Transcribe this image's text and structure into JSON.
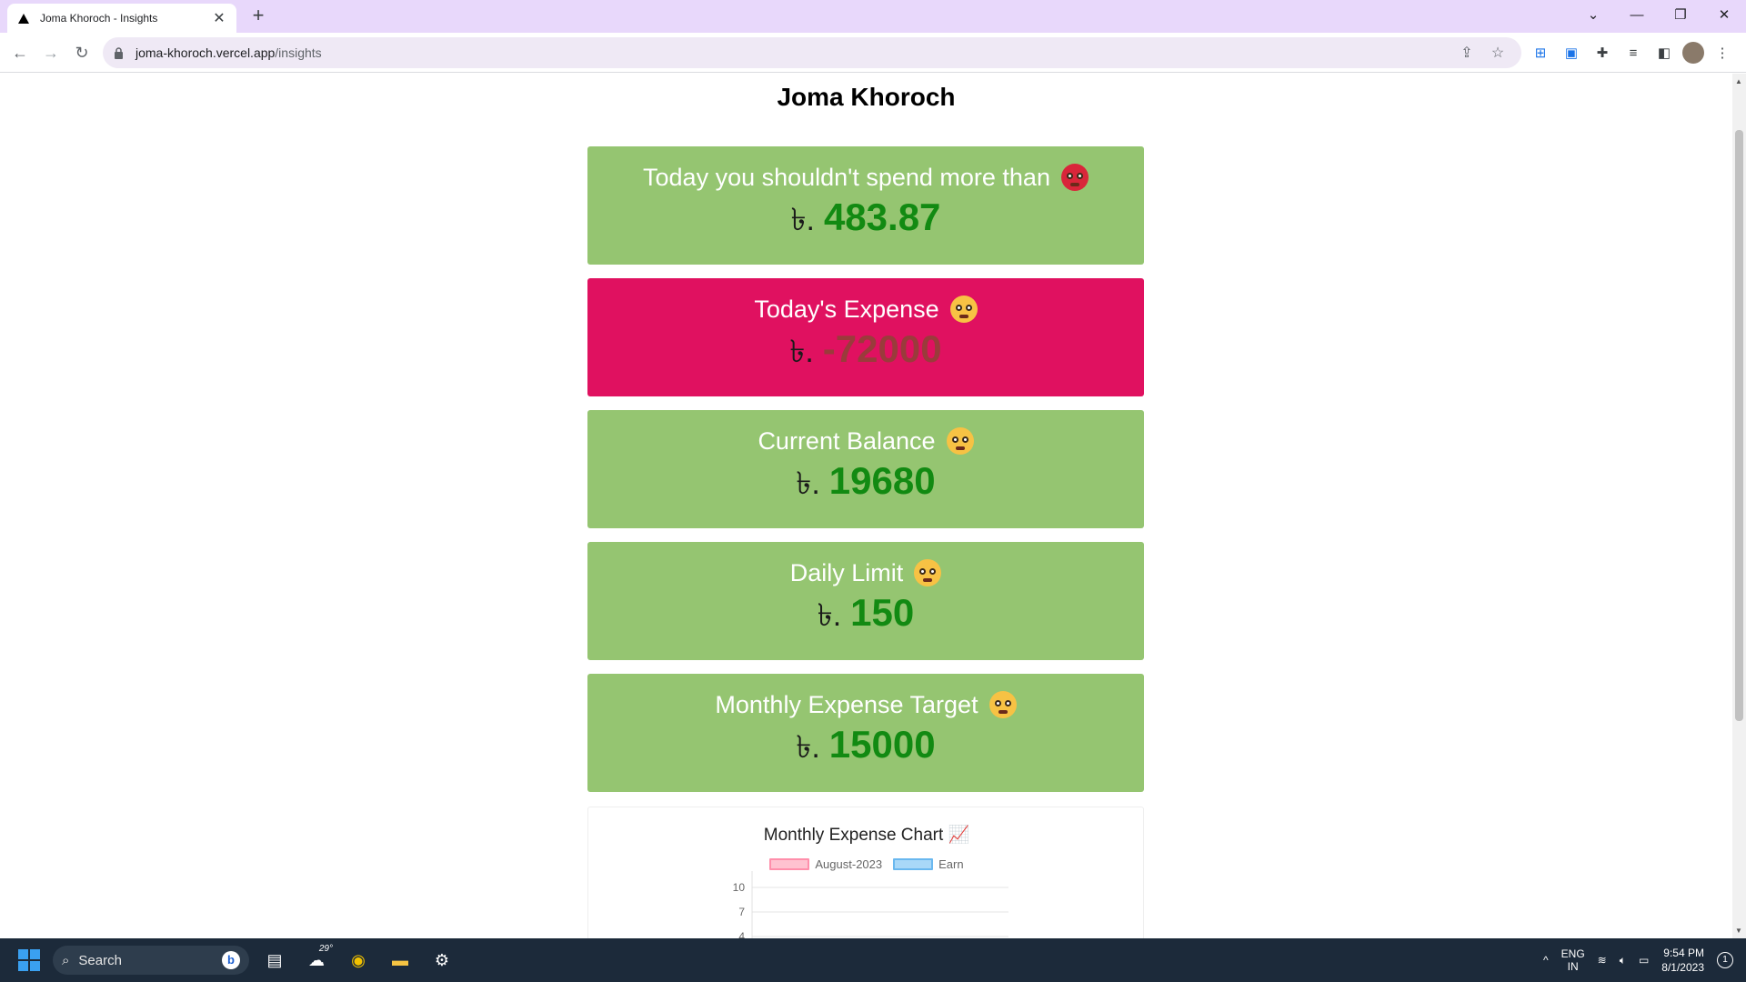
{
  "browser": {
    "tab_title": "Joma Khoroch - Insights",
    "tab_close": "✕",
    "new_tab": "+",
    "url_host": "joma-khoroch.vercel.app",
    "url_path": "/insights"
  },
  "page": {
    "title": "Joma Khoroch",
    "cards": [
      {
        "label": "Today you shouldn't spend more than",
        "currency": "৳.",
        "amount": "483.87",
        "emoji": "angry-face-icon"
      },
      {
        "label": "Today's Expense",
        "currency": "৳.",
        "amount": "-72000",
        "emoji": "pleading-face-icon"
      },
      {
        "label": "Current Balance",
        "currency": "৳.",
        "amount": "19680",
        "emoji": "shushing-face-icon"
      },
      {
        "label": "Daily Limit",
        "currency": "৳.",
        "amount": "150",
        "emoji": "neutral-face-icon"
      },
      {
        "label": "Monthly Expense Target",
        "currency": "৳.",
        "amount": "15000",
        "emoji": "drooling-face-icon"
      }
    ],
    "chart_title": "Monthly Expense Chart 📈"
  },
  "colors": {
    "card_green": "#95c571",
    "card_pink": "#e01160",
    "amount_green": "#128a12",
    "series_expense": "#ff9fb5",
    "series_earn": "#7ec3f5"
  },
  "chart_data": {
    "type": "bar",
    "title": "Monthly Expense Chart 📈",
    "series": [
      {
        "name": "August-2023",
        "color": "#ff9fb5",
        "values": []
      },
      {
        "name": "Earn",
        "color": "#7ec3f5",
        "values": []
      }
    ],
    "yticks": [
      "10",
      "7",
      "4"
    ],
    "ylim": [
      0,
      10
    ],
    "legend": "top-center",
    "grid": true
  },
  "taskbar": {
    "search_label": "Search",
    "weather_temp": "29°",
    "lang_top": "ENG",
    "lang_bottom": "IN",
    "time": "9:54 PM",
    "date": "8/1/2023",
    "notification_count": "1"
  }
}
